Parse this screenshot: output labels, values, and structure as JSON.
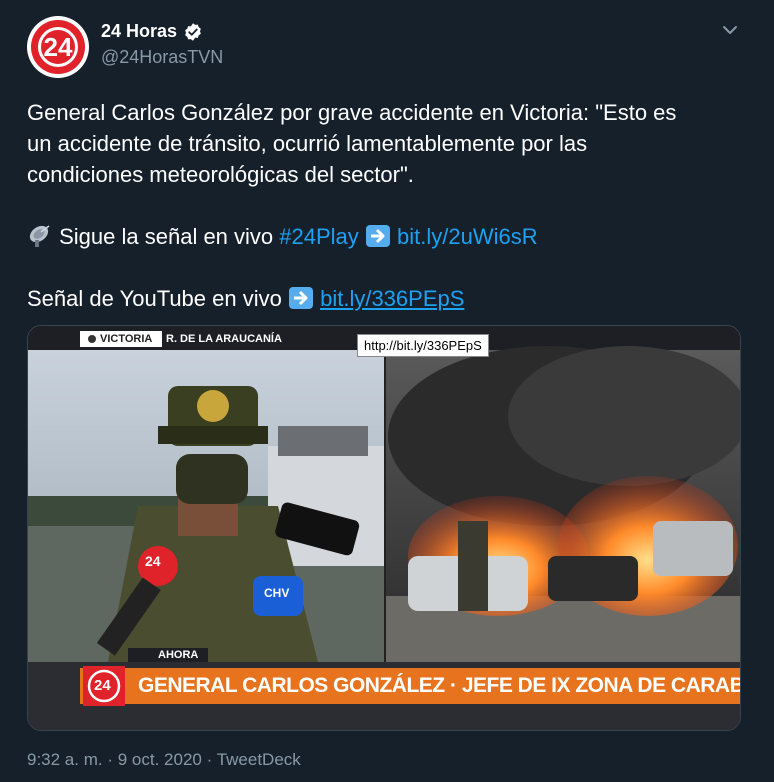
{
  "account": {
    "name": "24 Horas",
    "handle": "@24HorasTVN",
    "avatar_text": "24"
  },
  "tweet": {
    "line1": "General Carlos González por grave accidente en Victoria: \"Esto es",
    "line2": "un accidente de tránsito, ocurrió lamentablemente por las",
    "line3": "condiciones meteorológicas del sector\".",
    "signal_text": "Sigue la señal en vivo",
    "hashtag": "#24Play",
    "link1": "bit.ly/2uWi6sR",
    "youtube_text": "Señal de YouTube en vivo",
    "link2": "bit.ly/336PEpS"
  },
  "media": {
    "location": "VICTORIA",
    "region": "R. DE LA ARAUCANÍA",
    "live_label": "AHORA",
    "lower_third_name": "GENERAL CARLOS GONZÁLEZ",
    "lower_third_title": "JEFE DE IX ZONA DE CARABINEROS",
    "logo_text": "24",
    "mic_logo_1": "24",
    "mic_logo_2": "CHV"
  },
  "tooltip": "http://bit.ly/336PEpS",
  "footer": {
    "time": "9:32 a. m.",
    "date": "9 oct. 2020",
    "source": "TweetDeck",
    "separator": "·"
  },
  "colors": {
    "background": "#15202b",
    "link": "#1da1f2",
    "muted": "#8899a6",
    "brand_red": "#e0222b",
    "lower_third_orange": "#e8731f"
  }
}
